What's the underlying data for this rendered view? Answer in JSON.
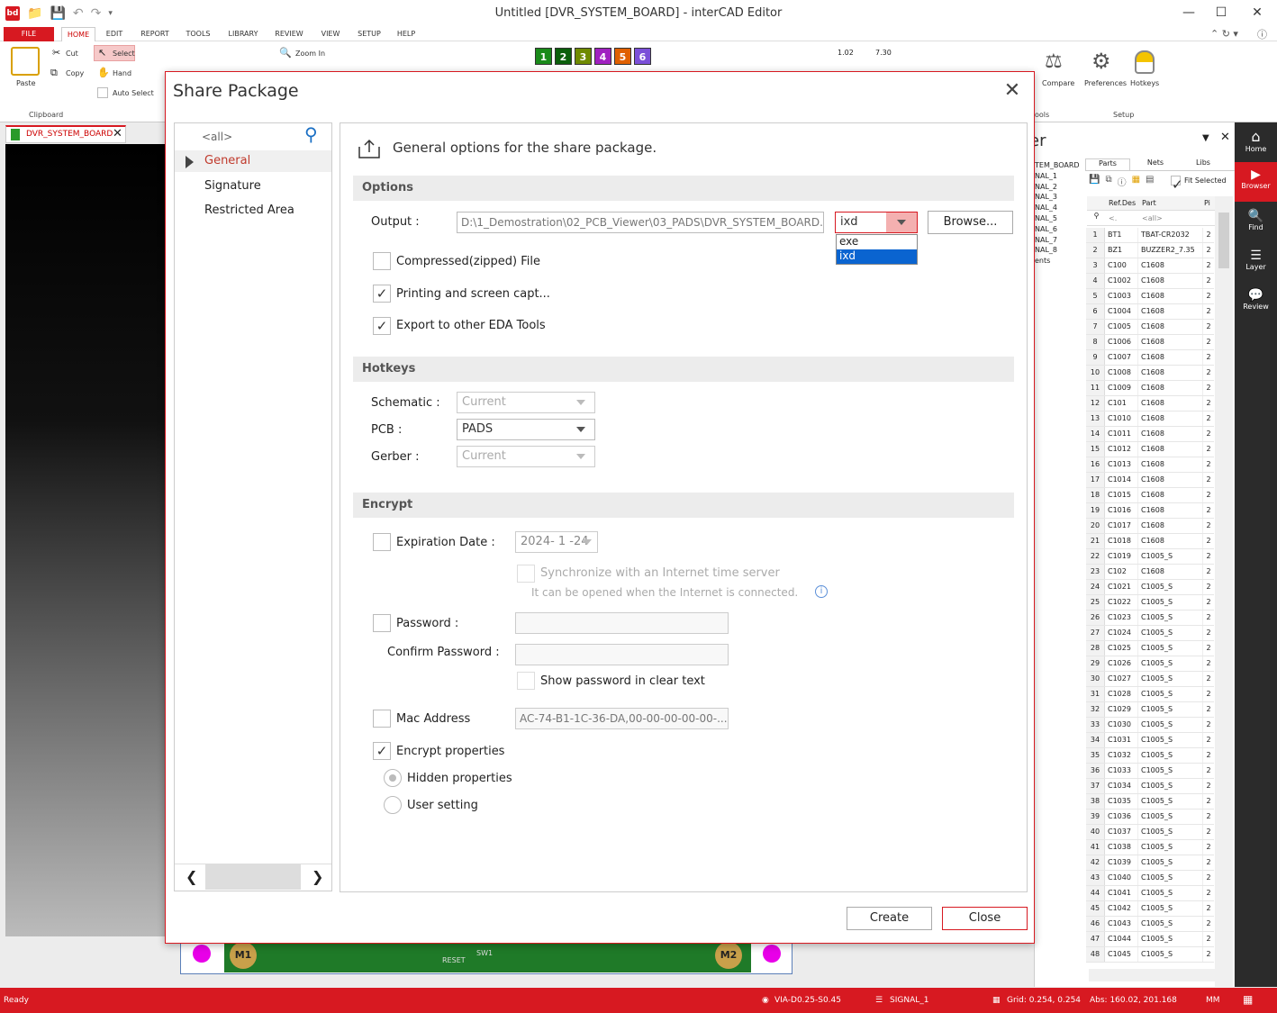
{
  "window": {
    "title": "Untitled [DVR_SYSTEM_BOARD] - interCAD Editor",
    "app_icon_text": "bd"
  },
  "ribbon_tabs": [
    "FILE",
    "HOME",
    "EDIT",
    "REPORT",
    "TOOLS",
    "LIBRARY",
    "REVIEW",
    "VIEW",
    "SETUP",
    "HELP"
  ],
  "ribbon": {
    "paste": "Paste",
    "cut": "Cut",
    "copy": "Copy",
    "select": "Select",
    "hand": "Hand",
    "auto_select": "Auto Select",
    "zoom_in": "Zoom In",
    "compare": "Compare",
    "preferences": "Preferences",
    "hotkeys": "Hotkeys",
    "group_clipboard": "Clipboard",
    "group_setup": "Setup",
    "group_tools_partial": "ools",
    "layer_numbers": [
      "1",
      "2",
      "3",
      "4",
      "5",
      "6"
    ],
    "measure_1": "1.02",
    "measure_2": "7.30"
  },
  "colors": {
    "accent": "#d71921",
    "layer_colors": [
      "#1a8a1a",
      "#0b5e0b",
      "#6f8a00",
      "#a020c0",
      "#e06000",
      "#7b4fd8"
    ]
  },
  "doc_tab": {
    "name": "DVR_SYSTEM_BOARD"
  },
  "pcb_strip": {
    "m1": "M1",
    "m2": "M2",
    "reset": "RESET",
    "sw": "SW1"
  },
  "right_panel": {
    "title_partial": "er",
    "signals": [
      "TEM_BOARD",
      "NAL_1",
      "NAL_2",
      "NAL_3",
      "NAL_4",
      "NAL_5",
      "NAL_6",
      "NAL_7",
      "NAL_8",
      "ents"
    ],
    "tabs": [
      "Parts",
      "Nets",
      "Libs"
    ],
    "fit_selected": "Fit Selected",
    "headers": {
      "refdes": "Ref.Des",
      "part": "Part",
      "pi": "Pi"
    },
    "filter_refdes": "<.",
    "filter_part": "<all>",
    "rows": [
      [
        "1",
        "BT1",
        "TBAT-CR2032",
        "2"
      ],
      [
        "2",
        "BZ1",
        "BUZZER2_7.35",
        "2"
      ],
      [
        "3",
        "C100",
        "C1608",
        "2"
      ],
      [
        "4",
        "C1002",
        "C1608",
        "2"
      ],
      [
        "5",
        "C1003",
        "C1608",
        "2"
      ],
      [
        "6",
        "C1004",
        "C1608",
        "2"
      ],
      [
        "7",
        "C1005",
        "C1608",
        "2"
      ],
      [
        "8",
        "C1006",
        "C1608",
        "2"
      ],
      [
        "9",
        "C1007",
        "C1608",
        "2"
      ],
      [
        "10",
        "C1008",
        "C1608",
        "2"
      ],
      [
        "11",
        "C1009",
        "C1608",
        "2"
      ],
      [
        "12",
        "C101",
        "C1608",
        "2"
      ],
      [
        "13",
        "C1010",
        "C1608",
        "2"
      ],
      [
        "14",
        "C1011",
        "C1608",
        "2"
      ],
      [
        "15",
        "C1012",
        "C1608",
        "2"
      ],
      [
        "16",
        "C1013",
        "C1608",
        "2"
      ],
      [
        "17",
        "C1014",
        "C1608",
        "2"
      ],
      [
        "18",
        "C1015",
        "C1608",
        "2"
      ],
      [
        "19",
        "C1016",
        "C1608",
        "2"
      ],
      [
        "20",
        "C1017",
        "C1608",
        "2"
      ],
      [
        "21",
        "C1018",
        "C1608",
        "2"
      ],
      [
        "22",
        "C1019",
        "C1005_S",
        "2"
      ],
      [
        "23",
        "C102",
        "C1608",
        "2"
      ],
      [
        "24",
        "C1021",
        "C1005_S",
        "2"
      ],
      [
        "25",
        "C1022",
        "C1005_S",
        "2"
      ],
      [
        "26",
        "C1023",
        "C1005_S",
        "2"
      ],
      [
        "27",
        "C1024",
        "C1005_S",
        "2"
      ],
      [
        "28",
        "C1025",
        "C1005_S",
        "2"
      ],
      [
        "29",
        "C1026",
        "C1005_S",
        "2"
      ],
      [
        "30",
        "C1027",
        "C1005_S",
        "2"
      ],
      [
        "31",
        "C1028",
        "C1005_S",
        "2"
      ],
      [
        "32",
        "C1029",
        "C1005_S",
        "2"
      ],
      [
        "33",
        "C1030",
        "C1005_S",
        "2"
      ],
      [
        "34",
        "C1031",
        "C1005_S",
        "2"
      ],
      [
        "35",
        "C1032",
        "C1005_S",
        "2"
      ],
      [
        "36",
        "C1033",
        "C1005_S",
        "2"
      ],
      [
        "37",
        "C1034",
        "C1005_S",
        "2"
      ],
      [
        "38",
        "C1035",
        "C1005_S",
        "2"
      ],
      [
        "39",
        "C1036",
        "C1005_S",
        "2"
      ],
      [
        "40",
        "C1037",
        "C1005_S",
        "2"
      ],
      [
        "41",
        "C1038",
        "C1005_S",
        "2"
      ],
      [
        "42",
        "C1039",
        "C1005_S",
        "2"
      ],
      [
        "43",
        "C1040",
        "C1005_S",
        "2"
      ],
      [
        "44",
        "C1041",
        "C1005_S",
        "2"
      ],
      [
        "45",
        "C1042",
        "C1005_S",
        "2"
      ],
      [
        "46",
        "C1043",
        "C1005_S",
        "2"
      ],
      [
        "47",
        "C1044",
        "C1005_S",
        "2"
      ],
      [
        "48",
        "C1045",
        "C1005_S",
        "2"
      ]
    ]
  },
  "right_bar": [
    "Home",
    "Browser",
    "Find",
    "Layer",
    "Review"
  ],
  "status": {
    "ready": "Ready",
    "via": "VIA-D0.25-S0.45",
    "layer": "SIGNAL_1",
    "grid": "Grid: 0.254, 0.254",
    "abs": "Abs: 160.02, 201.168",
    "unit": "MM"
  },
  "dialog": {
    "title": "Share Package",
    "search_placeholder": "<all>",
    "nav": [
      "General",
      "Signature",
      "Restricted Area"
    ],
    "header": "General options for the share package.",
    "options": {
      "section": "Options",
      "output_label": "Output :",
      "output_path": "D:\\1_Demostration\\02_PCB_Viewer\\03_PADS\\DVR_SYSTEM_BOARD.",
      "format_selected": "ixd",
      "format_options": [
        "exe",
        "ixd"
      ],
      "browse": "Browse...",
      "compressed": "Compressed(zipped) File",
      "printing": "Printing and screen capt...",
      "export": "Export to other EDA Tools"
    },
    "hotkeys": {
      "section": "Hotkeys",
      "schematic_label": "Schematic :",
      "schematic_value": "Current",
      "pcb_label": "PCB :",
      "pcb_value": "PADS",
      "gerber_label": "Gerber :",
      "gerber_value": "Current"
    },
    "encrypt": {
      "section": "Encrypt",
      "expiration_label": "Expiration Date :",
      "expiration_value": "2024- 1 -24",
      "sync_label": "Synchronize with an Internet time server",
      "sync_note": "It can be opened when the Internet is connected.",
      "password_label": "Password :",
      "confirm_label": "Confirm Password :",
      "show_password": "Show password in clear text",
      "mac_label": "Mac Address",
      "mac_value": "AC-74-B1-1C-36-DA,00-00-00-00-00-...",
      "encrypt_props": "Encrypt properties",
      "hidden_props": "Hidden properties",
      "user_setting": "User setting"
    },
    "create": "Create",
    "close": "Close"
  }
}
